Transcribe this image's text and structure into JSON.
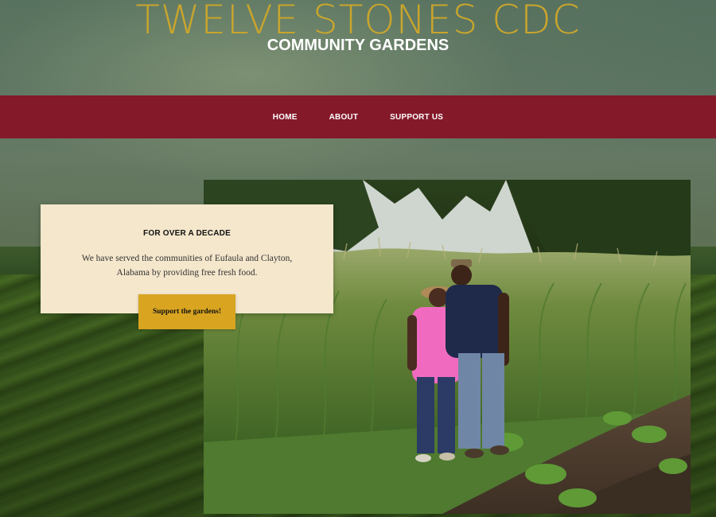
{
  "header": {
    "title": "TWELVE STONES CDC",
    "subtitle": "COMMUNITY GARDENS"
  },
  "nav": {
    "items": [
      {
        "label": "HOME"
      },
      {
        "label": "ABOUT"
      },
      {
        "label": "SUPPORT US"
      }
    ]
  },
  "intro_card": {
    "heading": "FOR OVER A DECADE",
    "text": "We have served the communities of Eufaula and Clayton, Alabama by providing free fresh food.",
    "button_label": "Support the gardens!"
  },
  "colors": {
    "title_gold": "#c9a52c",
    "nav_red": "#84192a",
    "card_cream": "#f4e7cc",
    "button_gold": "#d9a521"
  },
  "photo": {
    "subject": "garden-photo"
  }
}
